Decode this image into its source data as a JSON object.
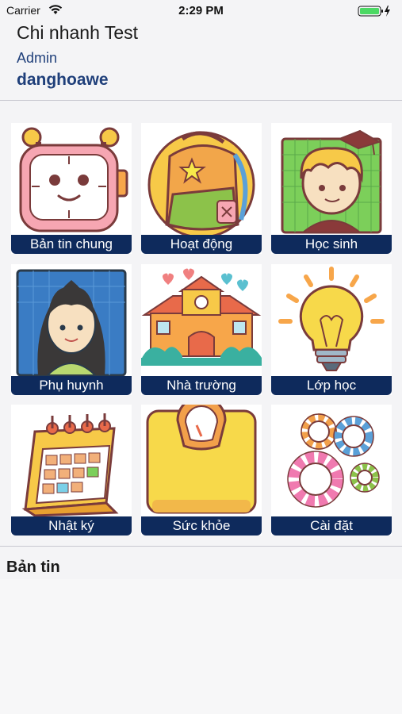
{
  "status_bar": {
    "carrier": "Carrier",
    "time": "2:29 PM",
    "battery_color": "#4cd964"
  },
  "header": {
    "branch": "Chi nhanh Test",
    "role": "Admin",
    "username": "danghoawe"
  },
  "menu": [
    {
      "label": "Bản tin chung",
      "icon": "alarm-clock-icon"
    },
    {
      "label": "Hoạt động",
      "icon": "backpack-icon"
    },
    {
      "label": "Học sinh",
      "icon": "student-icon"
    },
    {
      "label": "Phụ huynh",
      "icon": "parent-icon"
    },
    {
      "label": "Nhà trường",
      "icon": "school-icon"
    },
    {
      "label": "Lớp học",
      "icon": "lightbulb-icon"
    },
    {
      "label": "Nhật ký",
      "icon": "calendar-icon"
    },
    {
      "label": "Sức khỏe",
      "icon": "scale-icon"
    },
    {
      "label": "Cài đặt",
      "icon": "gears-icon"
    }
  ],
  "news": {
    "title": "Bản tin"
  },
  "colors": {
    "accent": "#0e2a5c",
    "text_blue": "#1f3f7a"
  }
}
